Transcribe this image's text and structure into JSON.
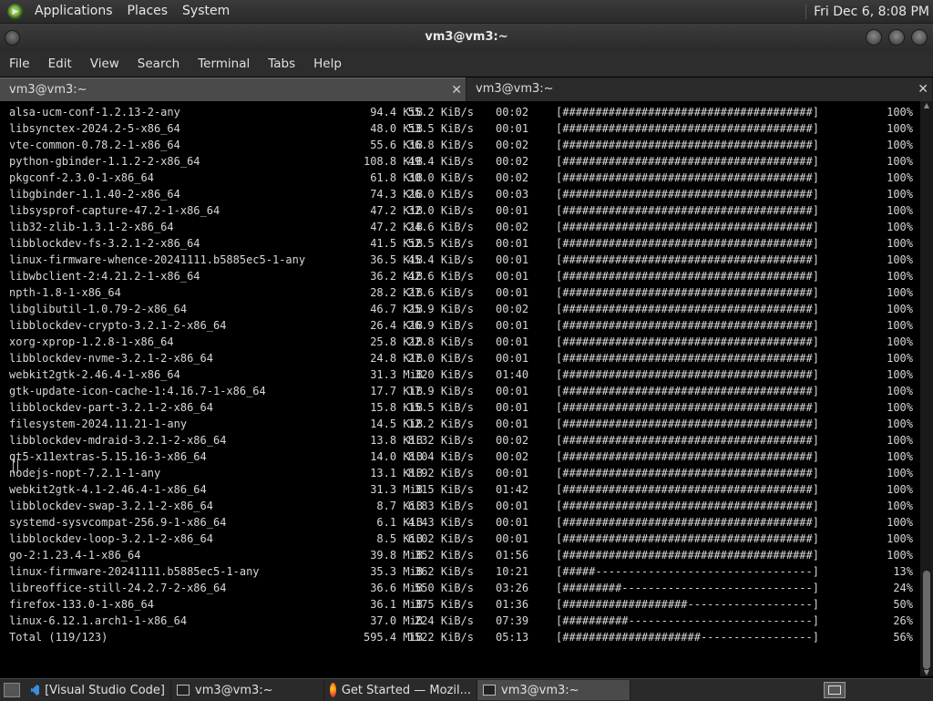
{
  "top_panel": {
    "menus": [
      "Applications",
      "Places",
      "System"
    ],
    "clock": "Fri Dec  6,  8:08 PM"
  },
  "window": {
    "title": "vm3@vm3:~"
  },
  "menubar": [
    "File",
    "Edit",
    "View",
    "Search",
    "Terminal",
    "Tabs",
    "Help"
  ],
  "tabs": [
    {
      "label": "vm3@vm3:~",
      "active": true
    },
    {
      "label": "vm3@vm3:~",
      "active": false
    }
  ],
  "terminal": {
    "rows": [
      {
        "name": "alsa-ucm-conf-1.2.13-2-any",
        "size": "94.4 KiB",
        "rate": "55.2 KiB/s",
        "eta": "00:02",
        "bar": "[######################################]",
        "pct": "100%"
      },
      {
        "name": "libsynctex-2024.2-5-x86_64",
        "size": "48.0 KiB",
        "rate": "53.5 KiB/s",
        "eta": "00:01",
        "bar": "[######################################]",
        "pct": "100%"
      },
      {
        "name": "vte-common-0.78.2-1-x86_64",
        "size": "55.6 KiB",
        "rate": "36.8 KiB/s",
        "eta": "00:02",
        "bar": "[######################################]",
        "pct": "100%"
      },
      {
        "name": "python-gbinder-1.1.2-2-x86_64",
        "size": "108.8 KiB",
        "rate": "49.4 KiB/s",
        "eta": "00:02",
        "bar": "[######################################]",
        "pct": "100%"
      },
      {
        "name": "pkgconf-2.3.0-1-x86_64",
        "size": "61.8 KiB",
        "rate": "30.0 KiB/s",
        "eta": "00:02",
        "bar": "[######################################]",
        "pct": "100%"
      },
      {
        "name": "libgbinder-1.1.40-2-x86_64",
        "size": "74.3 KiB",
        "rate": "26.0 KiB/s",
        "eta": "00:03",
        "bar": "[######################################]",
        "pct": "100%"
      },
      {
        "name": "libsysprof-capture-47.2-1-x86_64",
        "size": "47.2 KiB",
        "rate": "32.0 KiB/s",
        "eta": "00:01",
        "bar": "[######################################]",
        "pct": "100%"
      },
      {
        "name": "lib32-zlib-1.3.1-2-x86_64",
        "size": "47.2 KiB",
        "rate": "24.6 KiB/s",
        "eta": "00:02",
        "bar": "[######################################]",
        "pct": "100%"
      },
      {
        "name": "libblockdev-fs-3.2.1-2-x86_64",
        "size": "41.5 KiB",
        "rate": "52.5 KiB/s",
        "eta": "00:01",
        "bar": "[######################################]",
        "pct": "100%"
      },
      {
        "name": "linux-firmware-whence-20241111.b5885ec5-1-any",
        "size": "36.5 KiB",
        "rate": "45.4 KiB/s",
        "eta": "00:01",
        "bar": "[######################################]",
        "pct": "100%"
      },
      {
        "name": "libwbclient-2:4.21.2-1-x86_64",
        "size": "36.2 KiB",
        "rate": "42.6 KiB/s",
        "eta": "00:01",
        "bar": "[######################################]",
        "pct": "100%"
      },
      {
        "name": "npth-1.8-1-x86_64",
        "size": "28.2 KiB",
        "rate": "27.6 KiB/s",
        "eta": "00:01",
        "bar": "[######################################]",
        "pct": "100%"
      },
      {
        "name": "libglibutil-1.0.79-2-x86_64",
        "size": "46.7 KiB",
        "rate": "25.9 KiB/s",
        "eta": "00:02",
        "bar": "[######################################]",
        "pct": "100%"
      },
      {
        "name": "libblockdev-crypto-3.2.1-2-x86_64",
        "size": "26.4 KiB",
        "rate": "26.9 KiB/s",
        "eta": "00:01",
        "bar": "[######################################]",
        "pct": "100%"
      },
      {
        "name": "xorg-xprop-1.2.8-1-x86_64",
        "size": "25.8 KiB",
        "rate": "22.8 KiB/s",
        "eta": "00:01",
        "bar": "[######################################]",
        "pct": "100%"
      },
      {
        "name": "libblockdev-nvme-3.2.1-2-x86_64",
        "size": "24.8 KiB",
        "rate": "27.0 KiB/s",
        "eta": "00:01",
        "bar": "[######################################]",
        "pct": "100%"
      },
      {
        "name": "webkit2gtk-2.46.4-1-x86_64",
        "size": "31.3 MiB",
        "rate": "320 KiB/s",
        "eta": "01:40",
        "bar": "[######################################]",
        "pct": "100%"
      },
      {
        "name": "gtk-update-icon-cache-1:4.16.7-1-x86_64",
        "size": "17.7 KiB",
        "rate": "17.9 KiB/s",
        "eta": "00:01",
        "bar": "[######################################]",
        "pct": "100%"
      },
      {
        "name": "libblockdev-part-3.2.1-2-x86_64",
        "size": "15.8 KiB",
        "rate": "15.5 KiB/s",
        "eta": "00:01",
        "bar": "[######################################]",
        "pct": "100%"
      },
      {
        "name": "filesystem-2024.11.21-1-any",
        "size": "14.5 KiB",
        "rate": "12.2 KiB/s",
        "eta": "00:01",
        "bar": "[######################################]",
        "pct": "100%"
      },
      {
        "name": "libblockdev-mdraid-3.2.1-2-x86_64",
        "size": "13.8 KiB",
        "rate": "8.32 KiB/s",
        "eta": "00:02",
        "bar": "[######################################]",
        "pct": "100%"
      },
      {
        "name": "qt5-x11extras-5.15.16-3-x86_64",
        "size": "14.0 KiB",
        "rate": "8.04 KiB/s",
        "eta": "00:02",
        "bar": "[######################################]",
        "pct": "100%"
      },
      {
        "name": "nodejs-nopt-7.2.1-1-any",
        "size": "13.1 KiB",
        "rate": "8.92 KiB/s",
        "eta": "00:01",
        "bar": "[######################################]",
        "pct": "100%"
      },
      {
        "name": "webkit2gtk-4.1-2.46.4-1-x86_64",
        "size": "31.3 MiB",
        "rate": "315 KiB/s",
        "eta": "01:42",
        "bar": "[######################################]",
        "pct": "100%"
      },
      {
        "name": "libblockdev-swap-3.2.1-2-x86_64",
        "size": "8.7 KiB",
        "rate": "6.83 KiB/s",
        "eta": "00:01",
        "bar": "[######################################]",
        "pct": "100%"
      },
      {
        "name": "systemd-sysvcompat-256.9-1-x86_64",
        "size": "6.1 KiB",
        "rate": "4.43 KiB/s",
        "eta": "00:01",
        "bar": "[######################################]",
        "pct": "100%"
      },
      {
        "name": "libblockdev-loop-3.2.1-2-x86_64",
        "size": "8.5 KiB",
        "rate": "6.02 KiB/s",
        "eta": "00:01",
        "bar": "[######################################]",
        "pct": "100%"
      },
      {
        "name": "go-2:1.23.4-1-x86_64",
        "size": "39.8 MiB",
        "rate": "352 KiB/s",
        "eta": "01:56",
        "bar": "[######################################]",
        "pct": "100%"
      },
      {
        "name": "linux-firmware-20241111.b5885ec5-1-any",
        "size": "35.3 MiB",
        "rate": "362 KiB/s",
        "eta": "10:21",
        "bar": "[#####---------------------------------]",
        "pct": "13%"
      },
      {
        "name": "libreoffice-still-24.2.7-2-x86_64",
        "size": "36.6 MiB",
        "rate": "550 KiB/s",
        "eta": "03:26",
        "bar": "[#########-----------------------------]",
        "pct": "24%"
      },
      {
        "name": "firefox-133.0-1-x86_64",
        "size": "36.1 MiB",
        "rate": "375 KiB/s",
        "eta": "01:36",
        "bar": "[###################-------------------]",
        "pct": "50%"
      },
      {
        "name": "linux-6.12.1.arch1-1-x86_64",
        "size": "37.0 MiB",
        "rate": "224 KiB/s",
        "eta": "07:39",
        "bar": "[##########----------------------------]",
        "pct": "26%"
      },
      {
        "name": "Total (119/123)",
        "size": "595.4 MiB",
        "rate": "1522 KiB/s",
        "eta": "05:13",
        "bar": "[#####################-----------------]",
        "pct": "56%"
      }
    ]
  },
  "taskbar": {
    "items": [
      {
        "label": "[Visual Studio Code]",
        "icon": "vscode-icon",
        "active": false
      },
      {
        "label": "vm3@vm3:~",
        "icon": "terminal-icon",
        "active": false
      },
      {
        "label": "Get Started — Mozil...",
        "icon": "firefox-icon",
        "active": false
      },
      {
        "label": "vm3@vm3:~",
        "icon": "terminal-icon",
        "active": true
      }
    ]
  },
  "colors": {
    "terminal_bg": "#000000",
    "terminal_fg": "#d7d7d7",
    "panel_bg": "#2d2d2d"
  }
}
